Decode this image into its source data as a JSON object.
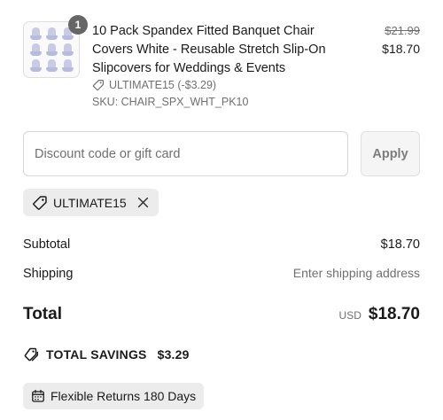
{
  "line_item": {
    "quantity": "1",
    "title": "10 Pack Spandex Fitted Banquet Chair Covers White - Reusable Stretch Slip-On Slipcovers for Weddings & Events",
    "compare_price": "$21.99",
    "price": "$18.70",
    "discount_text": "ULTIMATE15 (-$3.29)",
    "sku": "SKU: CHAIR_SPX_WHT_PK10"
  },
  "discount": {
    "placeholder": "Discount code or gift card",
    "value": "",
    "apply_label": "Apply",
    "applied_code": "ULTIMATE15"
  },
  "summary": {
    "subtotal_label": "Subtotal",
    "subtotal_value": "$18.70",
    "shipping_label": "Shipping",
    "shipping_value": "Enter shipping address",
    "total_label": "Total",
    "currency": "USD",
    "total_value": "$18.70",
    "savings_label": "TOTAL SAVINGS",
    "savings_value": "$3.29"
  },
  "returns": {
    "label": "Flexible Returns 180 Days"
  },
  "icons": {
    "tag": "tag-icon",
    "close": "close-icon",
    "tags": "tags-icon",
    "calendar": "calendar-icon"
  },
  "colors": {
    "muted_text": "#707070",
    "chip_bg": "#ececec",
    "badge_bg": "#666666"
  }
}
